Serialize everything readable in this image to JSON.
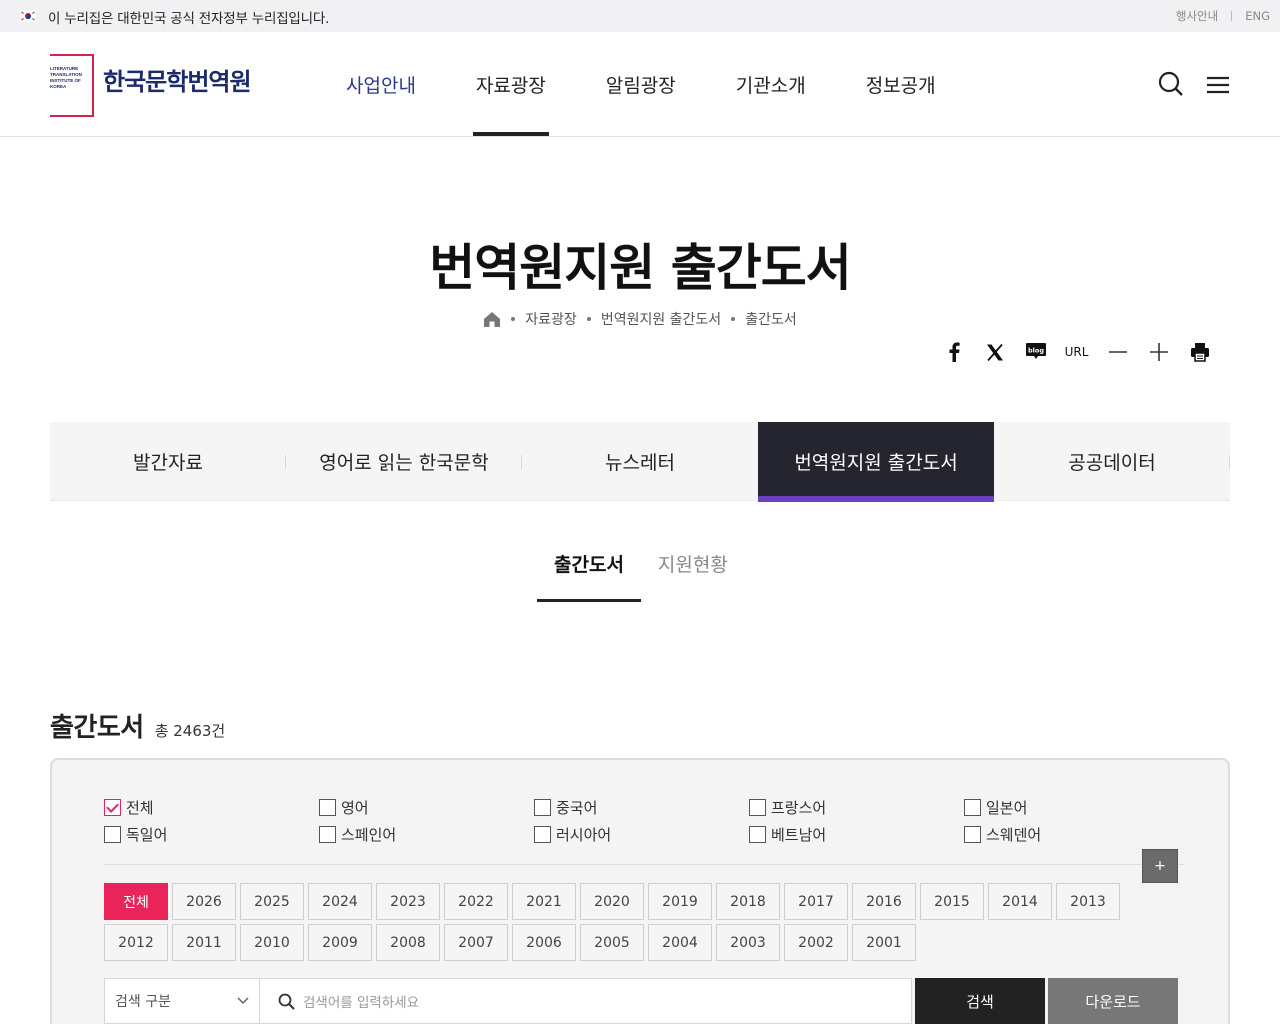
{
  "gov_banner": {
    "text": "이 누리집은 대한민국 공식 전자정부 누리집입니다.",
    "links": [
      "행사안내",
      "ENG"
    ]
  },
  "logo": {
    "name": "한국문학번역원",
    "mini_lines": [
      "LITERATURE",
      "TRANSLATION",
      "INSTITUTE OF",
      "KOREA"
    ]
  },
  "gnb": [
    "사업안내",
    "자료광장",
    "알림광장",
    "기관소개",
    "정보공개"
  ],
  "header_icons": [
    "search-icon",
    "menu-icon"
  ],
  "page_title": "번역원지원 출간도서",
  "breadcrumb": [
    "자료광장",
    "번역원지원 출간도서",
    "출간도서"
  ],
  "share": {
    "url_label": "URL",
    "icons": [
      "facebook-icon",
      "x-icon",
      "blog-icon",
      "url",
      "zoom-out-icon",
      "zoom-in-icon",
      "print-icon"
    ],
    "blog_label": "blog"
  },
  "tabs": [
    "발간자료",
    "영어로 읽는 한국문학",
    "뉴스레터",
    "번역원지원 출간도서",
    "공공데이터"
  ],
  "active_tab": 3,
  "subtabs": [
    "출간도서",
    "지원현황"
  ],
  "list": {
    "title": "출간도서",
    "count_label": "총 2463건"
  },
  "languages": [
    "전체",
    "영어",
    "중국어",
    "프랑스어",
    "일본어",
    "독일어",
    "스페인어",
    "러시아어",
    "베트남어",
    "스웨덴어"
  ],
  "more_button": "+",
  "years": [
    "전체",
    "2026",
    "2025",
    "2024",
    "2023",
    "2022",
    "2021",
    "2020",
    "2019",
    "2018",
    "2017",
    "2016",
    "2015",
    "2014",
    "2013",
    "2012",
    "2011",
    "2010",
    "2009",
    "2008",
    "2007",
    "2006",
    "2005",
    "2004",
    "2003",
    "2002",
    "2001"
  ],
  "search": {
    "select_label": "검색 구분",
    "placeholder": "검색어를 입력하세요",
    "search_button": "검색",
    "download_button": "다운로드"
  },
  "colors": {
    "accent": "#e8245a",
    "brand_navy": "#1b2b6b",
    "active_tab_bg": "#252530",
    "active_tab_bar": "#6a3fc4"
  }
}
